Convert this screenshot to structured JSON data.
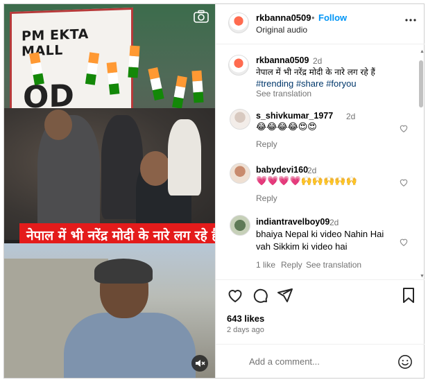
{
  "media": {
    "banner_text": "PM EKTA MALL",
    "banner_text_2": "OD",
    "caption": "नेपाल में भी नरेंद्र मोदी के नारे लग रहे हैं",
    "camera_icon": "camera-icon",
    "mute_icon": "muted-speaker-icon"
  },
  "header": {
    "username": "rkbanna0509",
    "separator": "•",
    "follow_label": "Follow",
    "audio_label": "Original audio",
    "more_icon": "more-options-icon"
  },
  "post": {
    "username": "rkbanna0509",
    "time": "2d",
    "caption": "नेपाल में भी नरेंद्र मोदी के नारे लग रहे हैं",
    "hashtags": "#trending #share #foryou",
    "see_translation": "See translation"
  },
  "comments": [
    {
      "username": "s_shivkumar_1977",
      "time": "2d",
      "text": "😂😂😂😂😍😍",
      "reply_label": "Reply"
    },
    {
      "username": "babydevi160",
      "time": "2d",
      "text": "💗💗💗💗🙌🙌🙌🙌🙌",
      "reply_label": "Reply"
    },
    {
      "username": "indiantravelboy09",
      "time": "2d",
      "text": "bhaiya Nepal ki video Nahin Hai vah Sikkim ki video hai",
      "likes_label": "1 like",
      "reply_label": "Reply",
      "see_translation": "See translation"
    }
  ],
  "actions": {
    "like_icon": "heart-icon",
    "comment_icon": "comment-icon",
    "share_icon": "share-icon",
    "save_icon": "bookmark-icon",
    "likes": "643 likes",
    "ago": "2 days ago"
  },
  "composer": {
    "placeholder": "Add a comment...",
    "emoji_icon": "emoji-icon"
  },
  "colors": {
    "accent": "#0095f6",
    "hashtag": "#00376b",
    "muted": "#737373",
    "caption_bg": "#e41b1b"
  }
}
